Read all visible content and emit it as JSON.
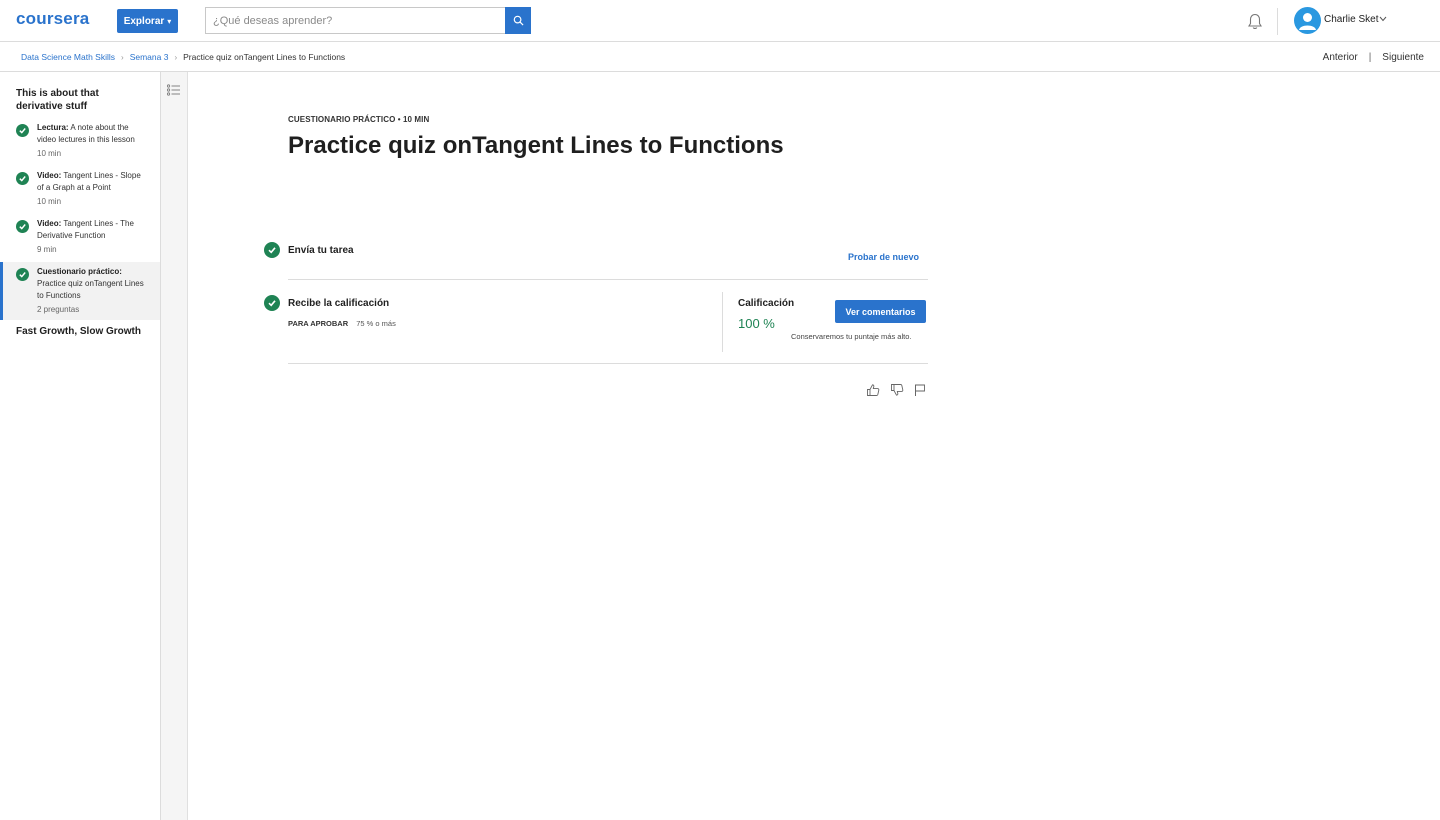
{
  "header": {
    "logo": "coursera",
    "explore_label": "Explorar",
    "search_placeholder": "¿Qué deseas aprender?",
    "user_name": "Charlie Sket"
  },
  "breadcrumb": {
    "items": [
      "Data Science Math Skills",
      "Semana 3",
      "Practice quiz onTangent Lines to Functions"
    ],
    "prev_label": "Anterior",
    "separator": "|",
    "next_label": "Siguiente"
  },
  "sidebar": {
    "module_title": "This is about that derivative stuff",
    "items": [
      {
        "type": "Lectura:",
        "title": " A note about the video lectures in this lesson",
        "duration": "10 min",
        "active": false
      },
      {
        "type": "Video:",
        "title": " Tangent Lines - Slope of a Graph at a Point",
        "duration": "10 min",
        "active": false
      },
      {
        "type": "Video:",
        "title": " Tangent Lines - The Derivative Function",
        "duration": "9 min",
        "active": false
      },
      {
        "type": "Cuestionario práctico:",
        "title": " Practice quiz onTangent Lines to Functions",
        "duration": "2 preguntas",
        "active": true
      }
    ],
    "next_module": "Fast Growth, Slow Growth"
  },
  "main": {
    "eyebrow": "Cuestionario práctico • 10 min",
    "title": "Practice quiz onTangent Lines to Functions",
    "step1_label": "Envía tu tarea",
    "retry_label": "Probar de nuevo",
    "step2_label": "Recibe la calificación",
    "pass_key": "Para aprobar",
    "pass_value": "75 % o más",
    "grade_label": "Calificación",
    "grade_value": "100 %",
    "feedback_button": "Ver comentarios",
    "keep_note": "Conservaremos tu puntaje más alto."
  },
  "colors": {
    "brand_blue": "#2a73cc",
    "success_green": "#1f8354"
  },
  "icons": [
    "search-icon",
    "bell-icon",
    "avatar-icon",
    "chevron-down-icon",
    "outline-icon",
    "check-icon",
    "thumbs-up-icon",
    "thumbs-down-icon",
    "flag-icon"
  ]
}
